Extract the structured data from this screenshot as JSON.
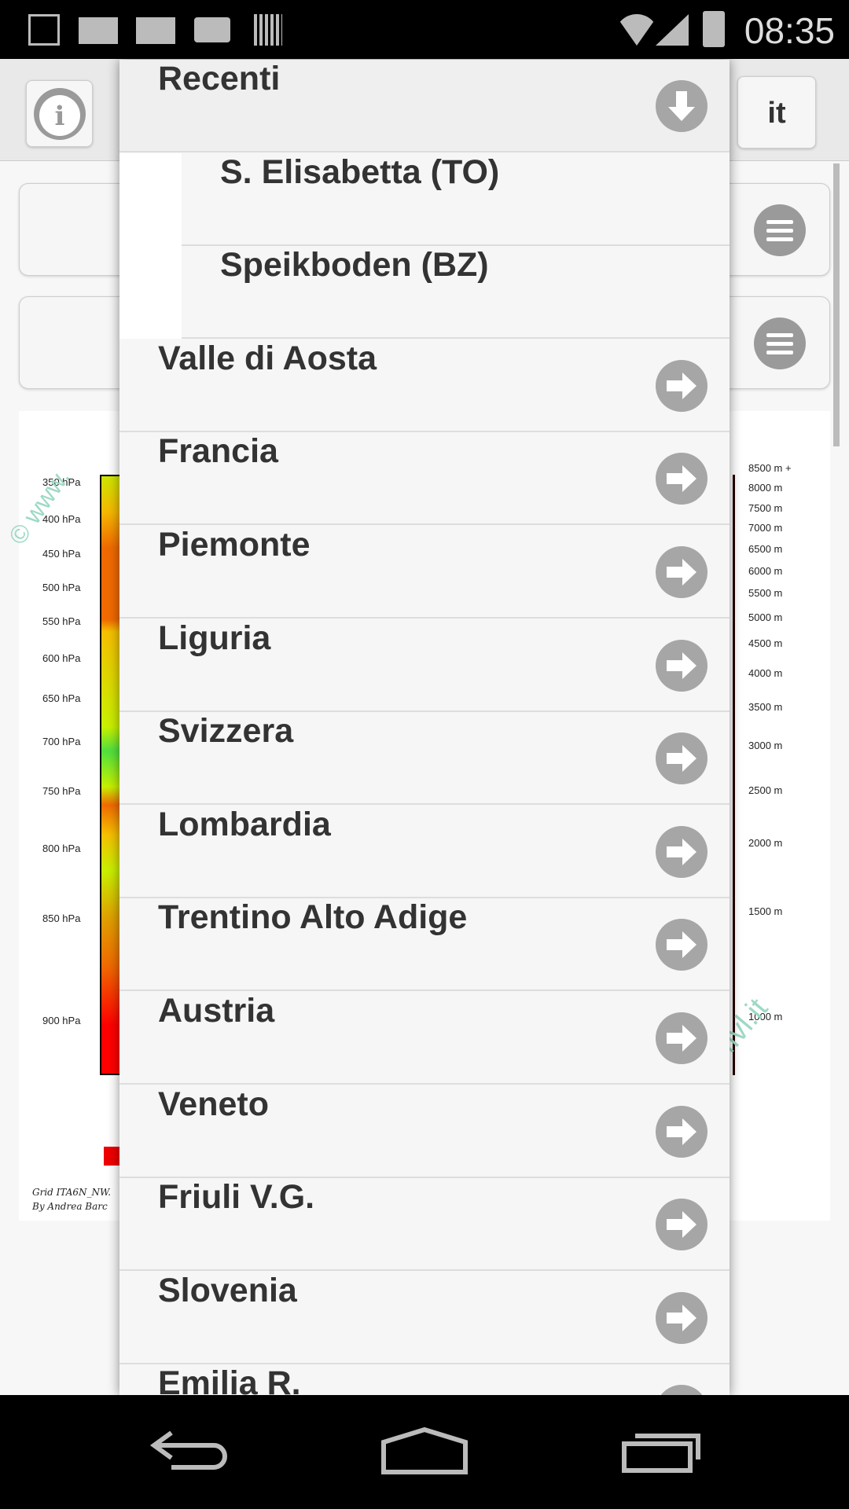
{
  "status_bar": {
    "time": "08:35",
    "icons": [
      "image-icon",
      "mail-icon",
      "mail-icon",
      "camera-icon",
      "barcode-icon",
      "wifi-icon",
      "signal-icon",
      "battery-icon"
    ]
  },
  "header": {
    "info_icon": "info-icon",
    "language": "it"
  },
  "cards": [
    {
      "icon": "menu-icon"
    },
    {
      "icon": "menu-icon"
    }
  ],
  "chart": {
    "pressure_labels": [
      "350 hPa",
      "400 hPa",
      "450 hPa",
      "500 hPa",
      "550 hPa",
      "600 hPa",
      "650 hPa",
      "700 hPa",
      "750 hPa",
      "800 hPa",
      "850 hPa",
      "900 hPa"
    ],
    "altitude_labels": [
      "8500 m +",
      "8000 m",
      "7500 m",
      "7000 m",
      "6500 m",
      "6000 m",
      "5500 m",
      "5000 m",
      "4500 m",
      "4000 m",
      "3500 m",
      "3000 m",
      "2500 m",
      "2000 m",
      "1500 m",
      "1000 m"
    ],
    "footer_line1": "Grid ITA6N_NW.",
    "footer_line2": "By Andrea Barc",
    "watermark_left": "© www.",
    "watermark_right": "w.fivl.it"
  },
  "dropdown": {
    "header": {
      "label": "Recenti",
      "icon": "arrow-down-circle-icon"
    },
    "recent": [
      {
        "label": "S. Elisabetta (TO)"
      },
      {
        "label": "Speikboden (BZ)"
      }
    ],
    "regions": [
      {
        "label": "Valle di Aosta"
      },
      {
        "label": "Francia"
      },
      {
        "label": "Piemonte"
      },
      {
        "label": "Liguria"
      },
      {
        "label": "Svizzera"
      },
      {
        "label": "Lombardia"
      },
      {
        "label": "Trentino Alto Adige"
      },
      {
        "label": "Austria"
      },
      {
        "label": "Veneto"
      },
      {
        "label": "Friuli V.G."
      },
      {
        "label": "Slovenia"
      },
      {
        "label": "Emilia R."
      }
    ],
    "region_icon": "arrow-right-circle-icon"
  },
  "nav_bar": {
    "icons": [
      "back-icon",
      "home-icon",
      "recent-apps-icon"
    ]
  },
  "colors": {
    "icon_grey": "#a6a6a6",
    "text": "#333333",
    "status_bg": "#000000"
  }
}
